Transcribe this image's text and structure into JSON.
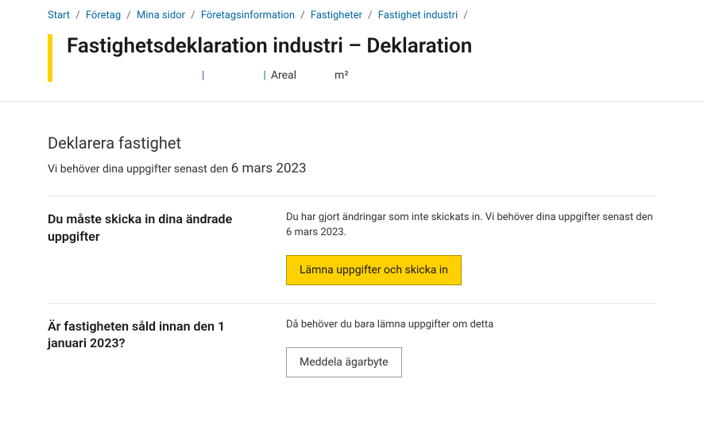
{
  "breadcrumb": {
    "items": [
      {
        "label": "Start"
      },
      {
        "label": "Företag"
      },
      {
        "label": "Mina sidor"
      },
      {
        "label": "Företagsinformation"
      },
      {
        "label": "Fastigheter"
      },
      {
        "label": "Fastighet industri"
      }
    ]
  },
  "header": {
    "title": "Fastighetsdeklaration industri – Deklaration",
    "meta": {
      "areal_label": "Areal",
      "areal_unit": "m²"
    }
  },
  "declare": {
    "title": "Deklarera fastighet",
    "deadline_prefix": "Vi behöver dina uppgifter senast den ",
    "deadline_date": "6 mars 2023"
  },
  "submit_block": {
    "heading": "Du måste skicka in dina ändrade uppgifter",
    "description": "Du har gjort ändringar som inte skickats in. Vi behöver dina uppgifter senast den 6 mars 2023.",
    "button": "Lämna uppgifter och skicka in"
  },
  "sold_block": {
    "heading": "Är fastigheten såld innan den 1 januari 2023?",
    "description": "Då behöver du bara lämna uppgifter om detta",
    "button": "Meddela ägarbyte"
  }
}
